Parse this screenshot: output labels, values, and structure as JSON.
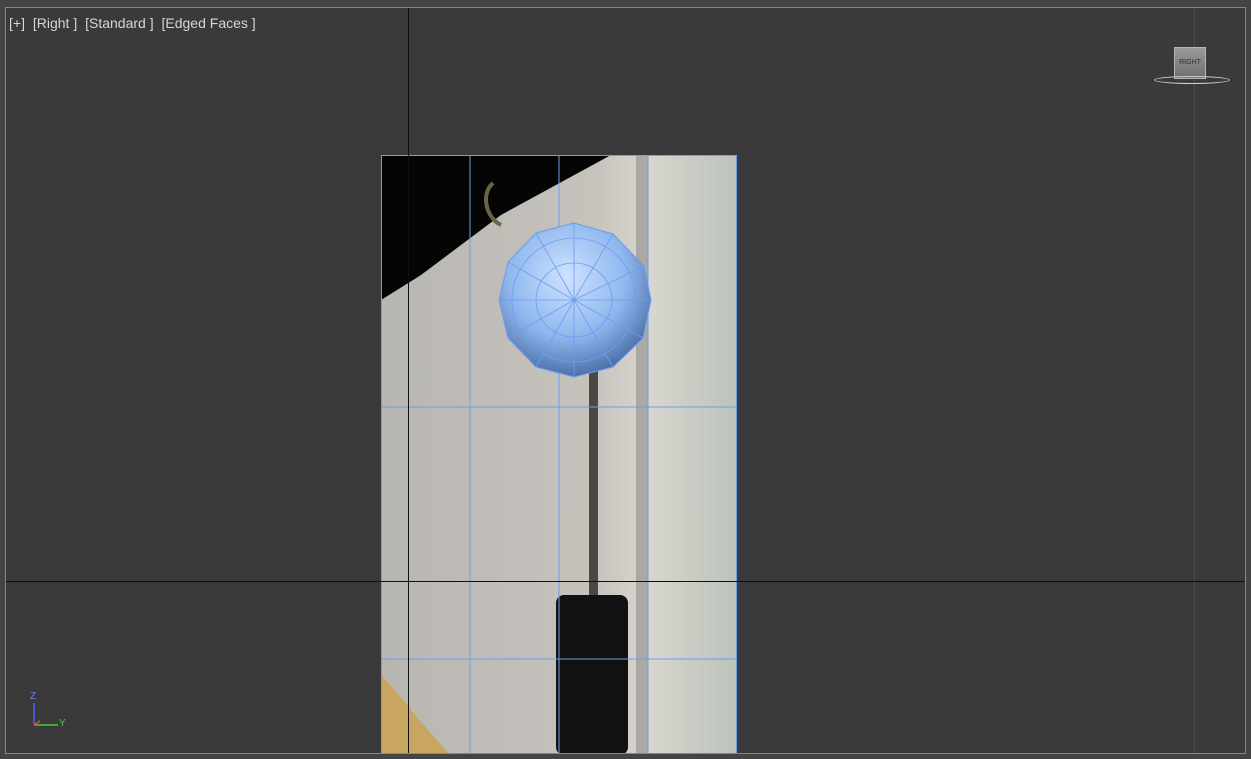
{
  "viewport": {
    "menu": [
      {
        "label": "[+]"
      },
      {
        "label": "[Right ]"
      },
      {
        "label": "[Standard ]"
      },
      {
        "label": "[Edged Faces ]"
      }
    ],
    "viewcube_label": "RIGHT",
    "axis_z": "Z",
    "axis_y": "Y"
  },
  "colors": {
    "viewport_bg": "#3a3a3a",
    "active_border": "#a08a3a",
    "wireframe": "#6a9ef0",
    "sphere": "#8fb7ee"
  }
}
